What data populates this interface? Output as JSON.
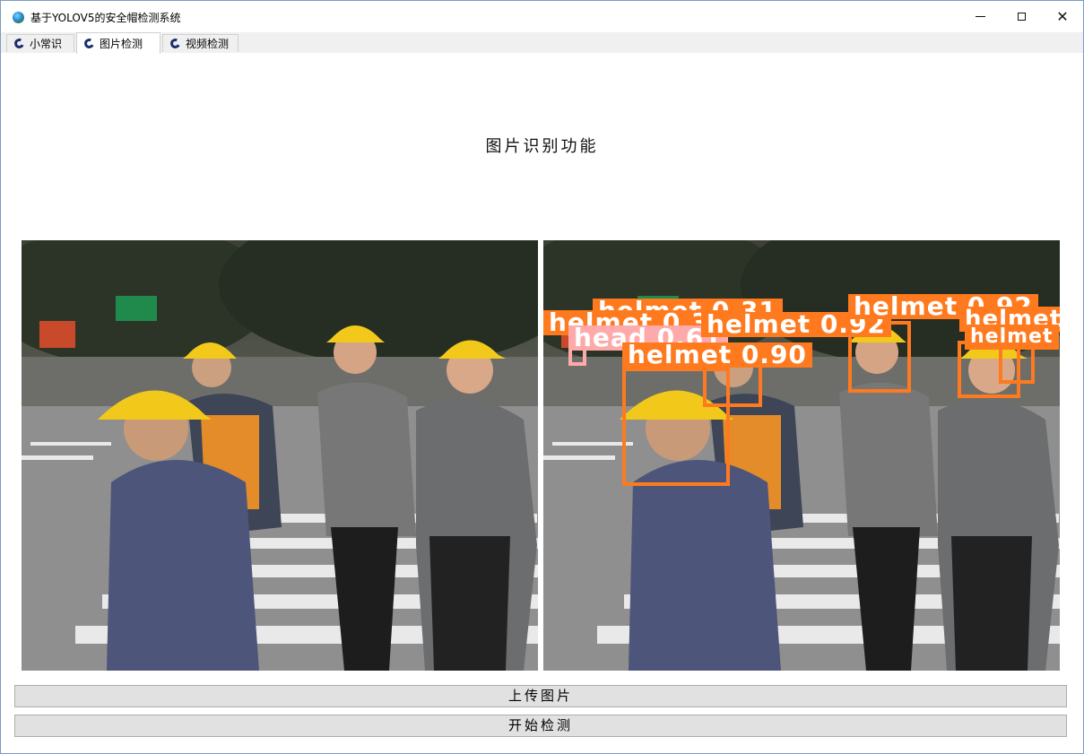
{
  "window": {
    "title": "基于YOLOV5的安全帽检测系统",
    "app_icon": "globe-icon",
    "controls": [
      "minimize-icon",
      "maximize-icon",
      "close-icon"
    ]
  },
  "tabs": [
    {
      "label": "小常识",
      "icon": "c-logo-icon",
      "active": false
    },
    {
      "label": "图片检测",
      "icon": "c-logo-icon",
      "active": true
    },
    {
      "label": "视频检测",
      "icon": "c-logo-icon",
      "active": false
    }
  ],
  "main": {
    "heading": "图片识别功能",
    "original_image_alt": "construction workers with yellow helmets crossing street",
    "detections": [
      {
        "label": "helmet 0.31"
      },
      {
        "label": "head 0.61"
      },
      {
        "label": "helmet 0.32"
      },
      {
        "label": "helmet 0.92"
      },
      {
        "label": "helmet 0.90"
      },
      {
        "label": "helmet 0.92"
      },
      {
        "label": "helmet"
      },
      {
        "label": "helmet"
      }
    ],
    "buttons": {
      "upload": "上传图片",
      "detect": "开始检测"
    }
  },
  "colors": {
    "detection_box": "#ff7a1e",
    "head_box": "#ffaaaa",
    "button_bg": "#e1e1e1",
    "helmet_yellow": "#f2c81a"
  }
}
